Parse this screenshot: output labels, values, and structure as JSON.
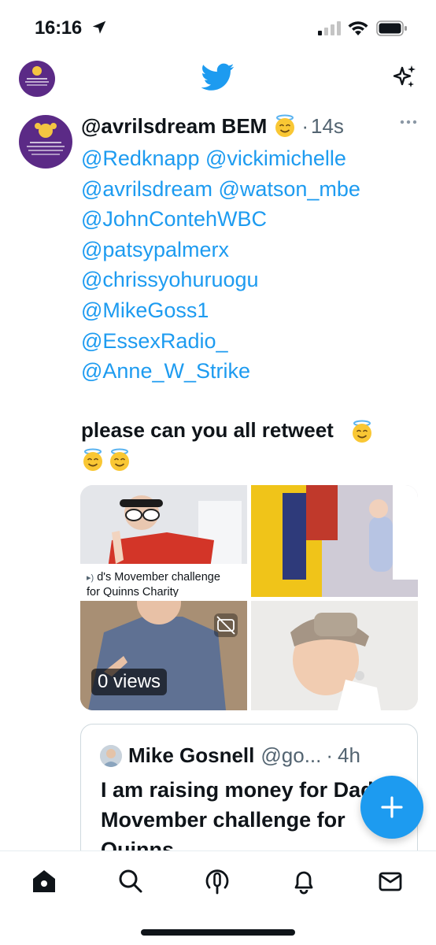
{
  "status_bar": {
    "time": "16:16"
  },
  "tweet": {
    "display_name": "@avrilsdream BEM",
    "time_ago": "14s",
    "separator": "·",
    "mentions": [
      "@Redknapp @vickimichelle",
      "@avrilsdream @watson_mbe",
      "@JohnContehWBC",
      "@patsypalmerx",
      "@chrissyohuruogu",
      "@MikeGoss1",
      "@EssexRadio_",
      "@Anne_W_Strike"
    ],
    "text": "please can you all retweet"
  },
  "media": {
    "link_card_title": "d's Movember challenge",
    "link_card_subtitle": "for Quinns Charity",
    "views_badge": "0 views"
  },
  "quote": {
    "name": "Mike Gosnell",
    "handle": "@go...",
    "separator": "·",
    "time_ago": "4h",
    "text": "I am raising money for Dad's Movember challenge for Quinns"
  },
  "colors": {
    "accent": "#1d9bf0",
    "text": "#0f1419",
    "muted": "#536471",
    "avatar_bg": "#5b2a86"
  },
  "icons": {
    "top_left": "avatar",
    "top_center": "twitter-bird-icon",
    "top_right": "sparkle-icon",
    "fab": "plus-icon",
    "nav": [
      "home-icon",
      "search-icon",
      "spaces-icon",
      "bell-icon",
      "mail-icon"
    ]
  }
}
